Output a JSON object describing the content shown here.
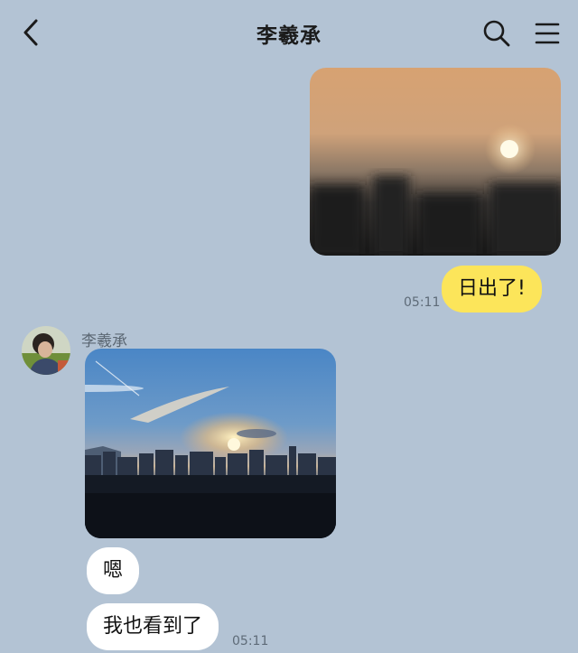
{
  "header": {
    "title": "李羲承",
    "back_icon": "chevron-left-icon",
    "search_icon": "search-icon",
    "menu_icon": "hamburger-menu-icon"
  },
  "messages": {
    "outgoing_text": "日出了!",
    "outgoing_time": "05:11",
    "sender_name": "李羲承",
    "incoming_text_1": "嗯",
    "incoming_text_2": "我也看到了",
    "incoming_time": "05:11"
  },
  "colors": {
    "background": "#b3c3d4",
    "outgoing_bubble": "#fce55a",
    "incoming_bubble": "#ffffff"
  }
}
